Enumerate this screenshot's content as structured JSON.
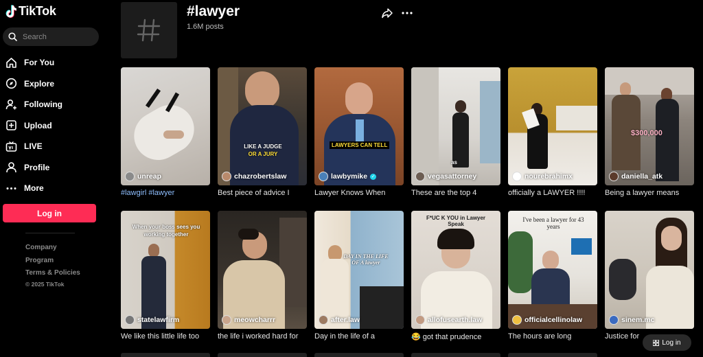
{
  "brand": {
    "name": "TikTok"
  },
  "search": {
    "placeholder": "Search"
  },
  "nav": {
    "items": [
      {
        "label": "For You",
        "icon": "home-icon"
      },
      {
        "label": "Explore",
        "icon": "compass-icon"
      },
      {
        "label": "Following",
        "icon": "following-icon"
      },
      {
        "label": "Upload",
        "icon": "upload-icon"
      },
      {
        "label": "LIVE",
        "icon": "live-icon"
      },
      {
        "label": "Profile",
        "icon": "profile-icon"
      },
      {
        "label": "More",
        "icon": "more-icon"
      }
    ]
  },
  "sidebar": {
    "login_label": "Log in"
  },
  "footer": {
    "company": "Company",
    "program": "Program",
    "terms": "Terms & Policies",
    "copyright": "© 2025 TikTok"
  },
  "hashtag": {
    "title": "#lawyer",
    "posts": "1.6M posts"
  },
  "videos": [
    {
      "username": "unreap",
      "caption": "#lawgirl #lawyer",
      "caption_is_link": true,
      "verified": false
    },
    {
      "username": "chazrobertslaw",
      "caption": "Best piece of advice I",
      "verified": false,
      "burn": "LIKE A JUDGE\nOR A JURY"
    },
    {
      "username": "lawbymike",
      "caption": "Lawyer Knows When",
      "verified": true,
      "burn": "LAWYERS CAN TELL"
    },
    {
      "username": "vegasattorney",
      "caption": "These are the top 4",
      "verified": false,
      "burn": "as"
    },
    {
      "username": "nourebrahimx",
      "caption": "officially a LAWYER !!!!",
      "verified": false
    },
    {
      "username": "daniella_atk",
      "caption": "Being a lawyer means",
      "verified": false,
      "burn": "$300,000"
    },
    {
      "username": "statelawfirm",
      "caption": "We like this little life too",
      "verified": false,
      "burn": "When your boss sees you working together"
    },
    {
      "username": "meowcharrr",
      "caption": "the life i worked hard for",
      "verified": false
    },
    {
      "username": "after.law",
      "caption": "Day in the life of a",
      "verified": false,
      "burn": "DAY IN THE LIFE OF A lawyer"
    },
    {
      "username": "allofusearth.law",
      "caption": "😂 got that prudence",
      "verified": false,
      "burn": "F*UC K YOU in Lawyer Speak"
    },
    {
      "username": "officialcellinolaw",
      "caption": "The hours are long",
      "verified": false,
      "burn": "I've been a lawyer for 43 years"
    },
    {
      "username": "sinem.mc",
      "caption": "Justice for",
      "verified": false
    }
  ],
  "floating": {
    "login_label": "Log in"
  },
  "colors": {
    "accent": "#fe2c55",
    "link": "#8fbfff",
    "bg": "#000000"
  }
}
